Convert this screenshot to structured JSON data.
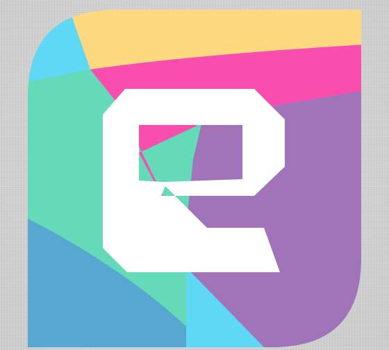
{
  "logo": {
    "glyph": "e",
    "icon": "letter-e-logo-icon",
    "colors": {
      "yellow": "#FFD980",
      "cyan": "#5FD8F5",
      "pink": "#F94EAE",
      "teal": "#64DAB9",
      "purple": "#A174B9",
      "blue": "#57A8D0",
      "glyph": "#FFFFFF",
      "background": "#D4D4D4"
    }
  }
}
